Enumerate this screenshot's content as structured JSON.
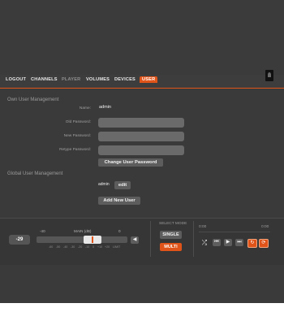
{
  "nav": {
    "items": [
      {
        "label": "LOGOUT"
      },
      {
        "label": "CHANNELS"
      },
      {
        "label": "PLAYER"
      },
      {
        "label": "VOLUMES"
      },
      {
        "label": "DEVICES"
      },
      {
        "label": "USER"
      }
    ],
    "active": "USER"
  },
  "own_user": {
    "title": "Own User Management",
    "name_label": "Name:",
    "name_value": "admin",
    "old_password_label": "Old Password:",
    "new_password_label": "New Password:",
    "retype_password_label": "Retype Password:",
    "change_button": "Change User Password"
  },
  "global_user": {
    "title": "Global User Management",
    "user_name": "admin",
    "edit_button": "edit",
    "add_button": "Add New User"
  },
  "player": {
    "volume_display": "-29",
    "scale_top": {
      "left": "-40",
      "middle": "MAIN (dB)",
      "right": "0"
    },
    "scale_bottom": [
      "-60",
      "-50",
      "-40",
      "-30",
      "-20",
      "-10",
      "0",
      "+10",
      "+20",
      "LIMIT"
    ],
    "volume_level": 0.58,
    "mute_icon": "speaker-icon",
    "select_mode_title": "SELECT MODE",
    "mode_single": "SINGLE",
    "mode_multi": "MULTI",
    "time_start": "0:00",
    "time_end": "0:00",
    "controls": [
      "shuffle-icon",
      "previous-icon",
      "play-icon",
      "next-icon",
      "repeat-one-icon",
      "repeat-icon"
    ]
  },
  "colors": {
    "accent": "#e0541a",
    "background": "#3a3a3a"
  }
}
